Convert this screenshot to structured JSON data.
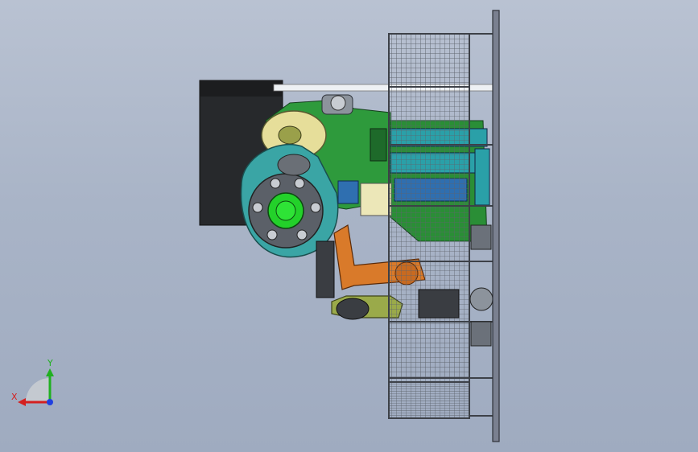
{
  "viewport": {
    "background_top": "#b9c2d2",
    "background_bottom": "#9fabc0"
  },
  "model": {
    "colors": {
      "frame": "#3d4148",
      "mesh": "#6b717a",
      "green_body": "#2e9a3c",
      "teal_plate": "#3aa5a5",
      "orange_arm": "#d97a2a",
      "olive_arm": "#9aaa4a",
      "hub_green": "#22d12a",
      "black_block": "#26282b",
      "blue_cover": "#2f6fb0"
    }
  },
  "triad": {
    "x_label": "X",
    "y_label": "Y",
    "x_color": "#d42020",
    "y_color": "#20b020",
    "z_color": "#2040e0"
  }
}
